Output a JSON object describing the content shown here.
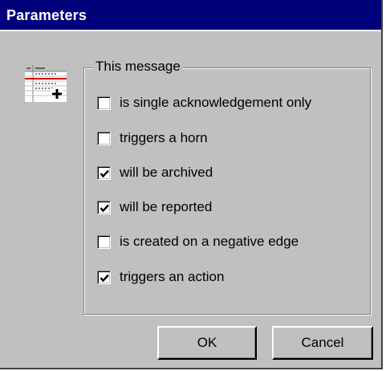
{
  "window": {
    "title": "Parameters"
  },
  "group": {
    "label": "This message",
    "options": [
      {
        "label": "is single acknowledgement only",
        "checked": false
      },
      {
        "label": "triggers a horn",
        "checked": false
      },
      {
        "label": "will be archived",
        "checked": true
      },
      {
        "label": "will be reported",
        "checked": true
      },
      {
        "label": "is created on a negative edge",
        "checked": false
      },
      {
        "label": "triggers an action",
        "checked": true
      }
    ]
  },
  "buttons": {
    "ok": "OK",
    "cancel": "Cancel"
  },
  "icons": {
    "message": "message-list-icon",
    "check": "checkmark-icon"
  }
}
